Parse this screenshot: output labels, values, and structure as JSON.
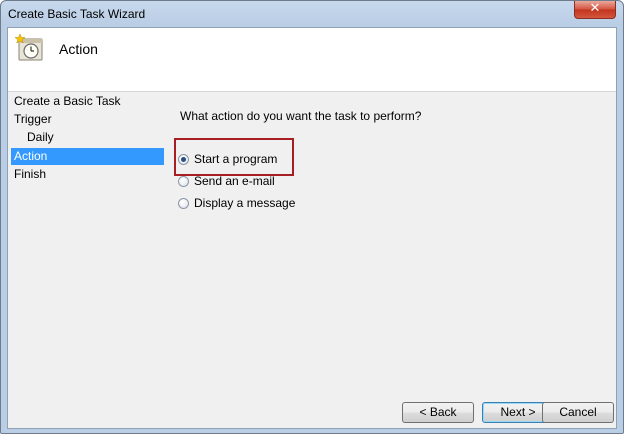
{
  "window": {
    "title": "Create Basic Task Wizard",
    "close_glyph": "✕"
  },
  "header": {
    "icon": "task-scheduler-clock-icon",
    "title": "Action"
  },
  "nav": {
    "items": [
      {
        "label": "Create a Basic Task",
        "active": false
      },
      {
        "label": "Trigger",
        "active": false
      },
      {
        "label": "Daily",
        "active": false
      },
      {
        "label": "Action",
        "active": true
      },
      {
        "label": "Finish",
        "active": false
      }
    ]
  },
  "main": {
    "question": "What action do you want the task to perform?",
    "options": [
      {
        "label": "Start a program",
        "checked": true
      },
      {
        "label": "Send an e-mail",
        "checked": false
      },
      {
        "label": "Display a message",
        "checked": false
      }
    ]
  },
  "buttons": {
    "back": "< Back",
    "next": "Next >",
    "cancel": "Cancel"
  },
  "colors": {
    "selection": "#3399ff",
    "highlight_box": "#a61d24"
  }
}
